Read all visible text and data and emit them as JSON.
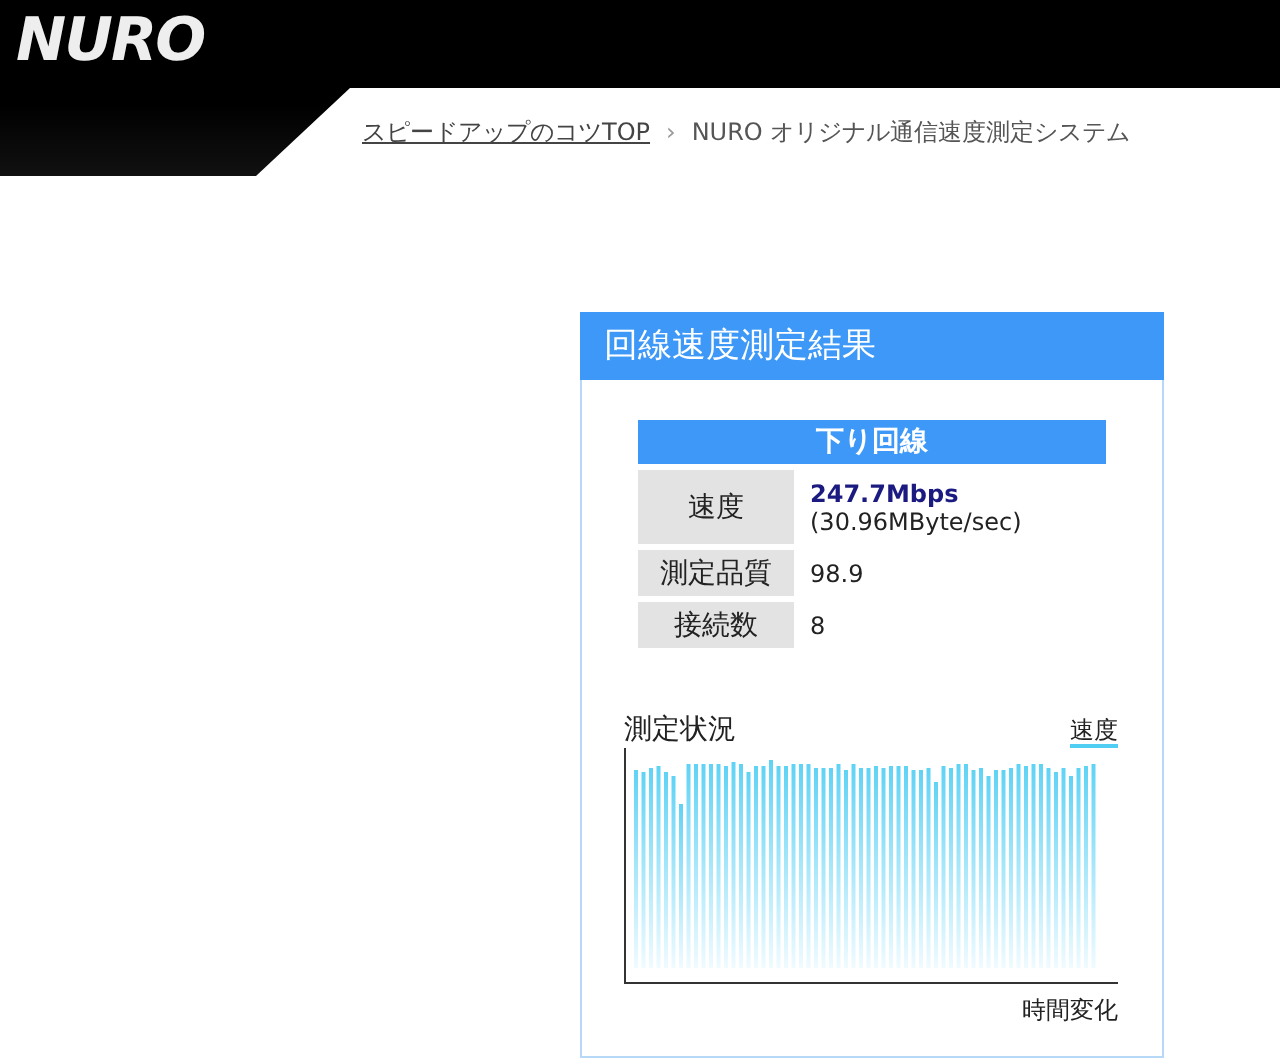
{
  "header": {
    "logo": "NURO",
    "breadcrumb": [
      {
        "kind": "link",
        "text": "スピードアップのコツTOP"
      },
      {
        "kind": "separator",
        "text": "›"
      },
      {
        "kind": "current",
        "text": "NURO オリジナル通信速度測定システム"
      }
    ]
  },
  "panel": {
    "title": "回線速度測定結果",
    "table": {
      "heading": "下り回線",
      "rows": [
        {
          "label": "速度",
          "value": "247.7Mbps",
          "detail": "(30.96MByte/sec)"
        },
        {
          "label": "測定品質",
          "value": "98.9"
        },
        {
          "label": "接続数",
          "value": "8"
        }
      ]
    },
    "chart": {
      "title": "測定状況",
      "legend": "速度",
      "xlabel": "時間変化"
    }
  }
}
